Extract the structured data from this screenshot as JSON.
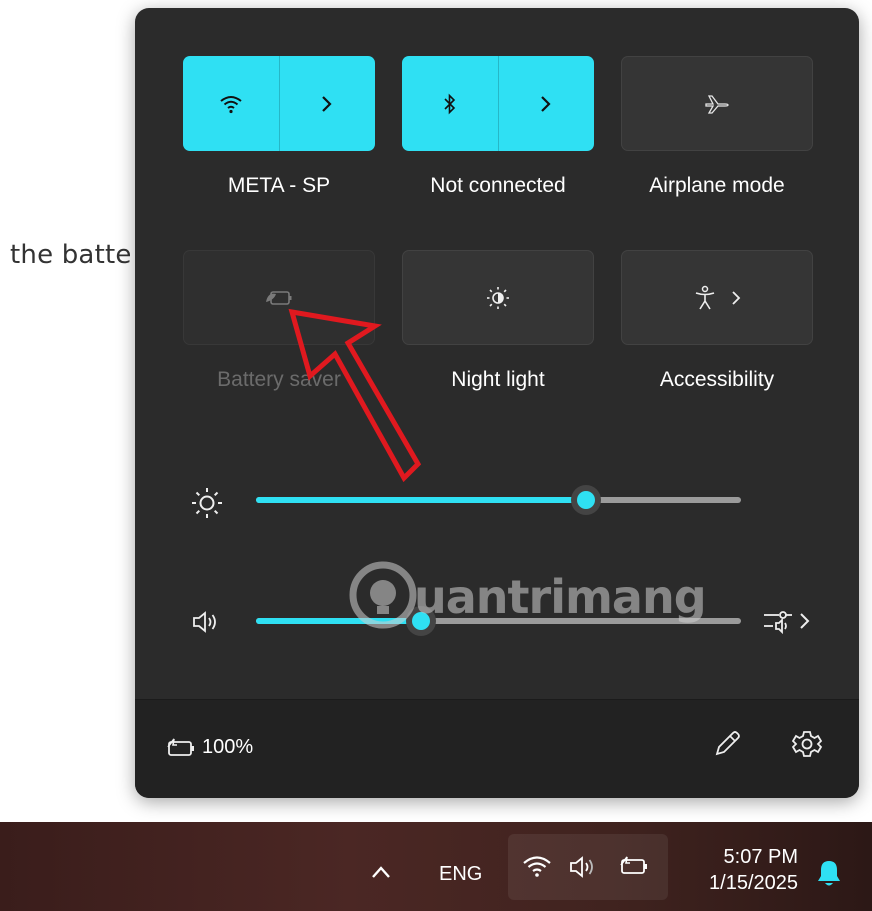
{
  "background": {
    "text": "the batte"
  },
  "tiles": [
    {
      "label": "META - SP",
      "icon": "wifi-icon",
      "state": "on",
      "secondary_icon": "chevron-right-icon"
    },
    {
      "label": "Not connected",
      "icon": "bluetooth-icon",
      "state": "on",
      "secondary_icon": "chevron-right-icon"
    },
    {
      "label": "Airplane mode",
      "icon": "airplane-icon",
      "state": "off"
    },
    {
      "label": "Battery saver",
      "icon": "battery-saver-icon",
      "state": "disabled"
    },
    {
      "label": "Night light",
      "icon": "night-light-icon",
      "state": "off"
    },
    {
      "label": "Accessibility",
      "icon": "accessibility-icon",
      "state": "off",
      "secondary_icon": "chevron-right-icon"
    }
  ],
  "sliders": {
    "brightness": {
      "icon": "brightness-icon",
      "level": 0.68
    },
    "volume": {
      "icon": "speaker-icon",
      "level": 0.34,
      "end_icon": "audio-output-icon"
    }
  },
  "footer": {
    "battery_text": "100%",
    "icons": [
      "battery-charging-icon",
      "edit-pencil-icon",
      "settings-gear-icon"
    ]
  },
  "taskbar": {
    "language": "ENG",
    "time": "5:07 PM",
    "date": "1/15/2025",
    "icons": [
      "chevron-up-icon",
      "wifi-icon",
      "speaker-icon",
      "battery-icon",
      "notification-bell-icon"
    ]
  },
  "watermark": {
    "text": "uantrimang"
  },
  "colors": {
    "accent": "#2fe0f3",
    "panel": "#2b2b2b",
    "annotation_arrow": "#e0191f"
  }
}
